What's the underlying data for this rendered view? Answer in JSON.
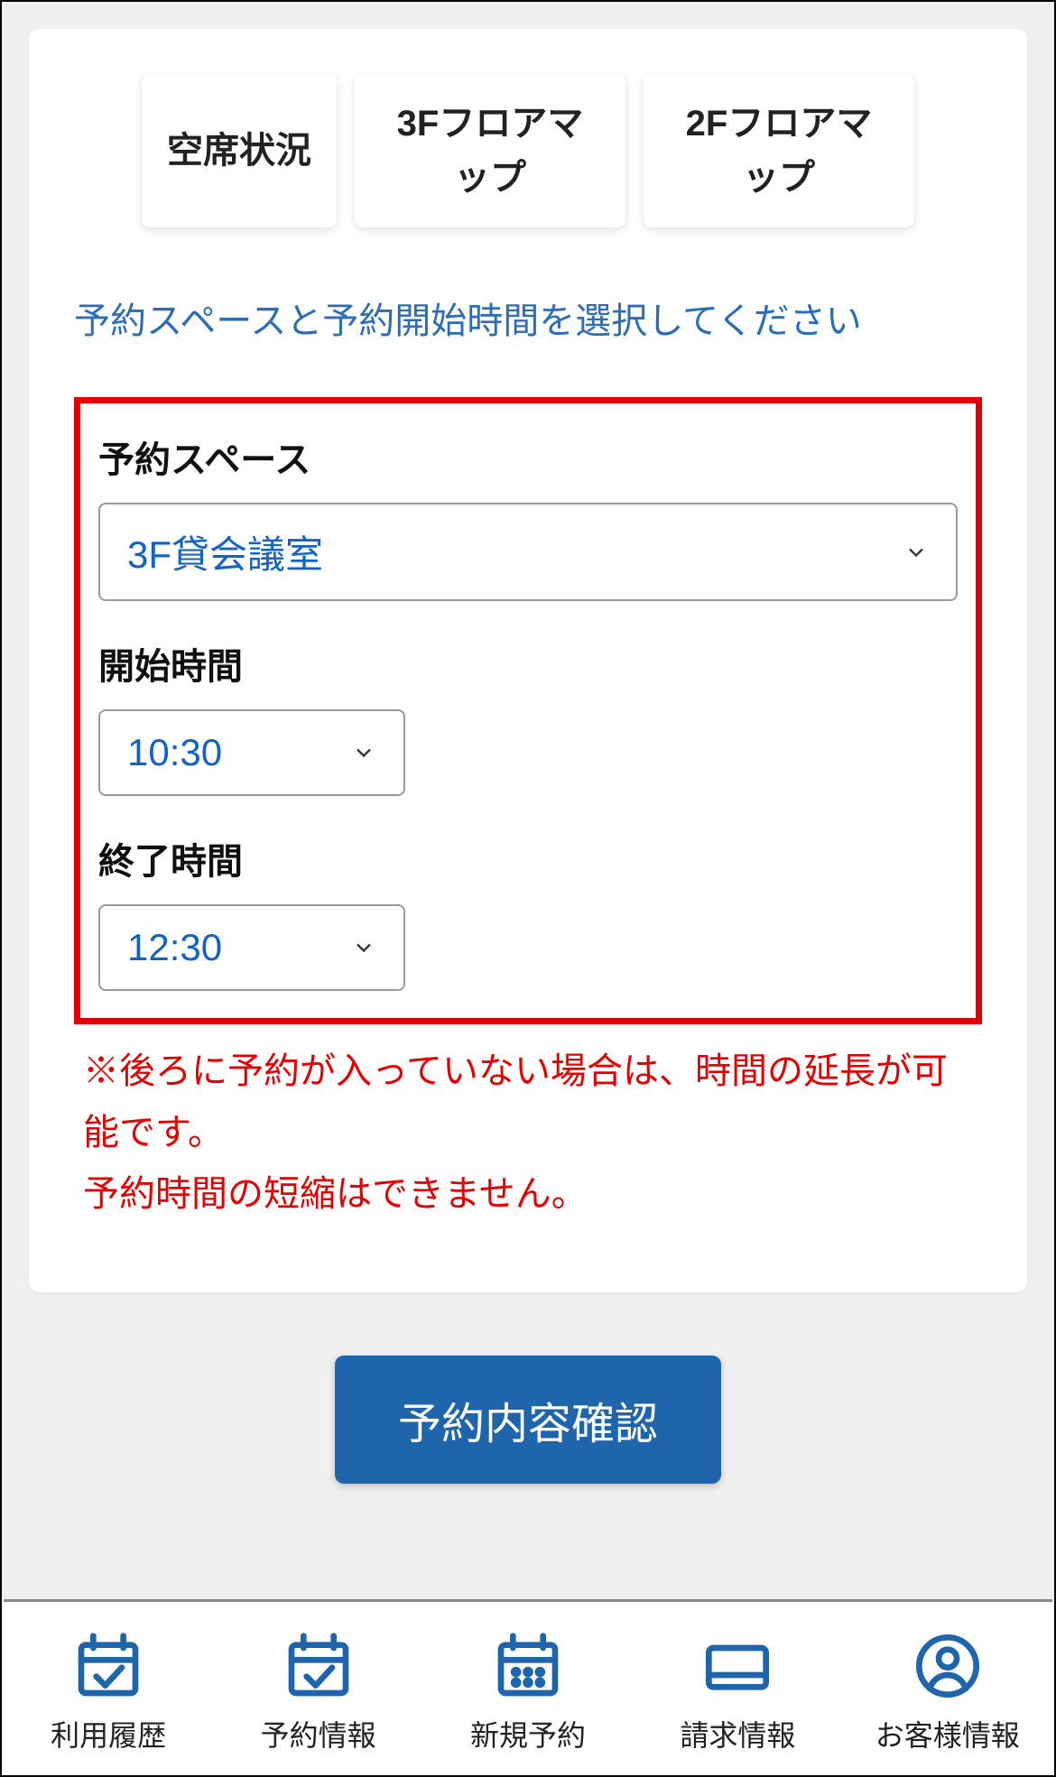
{
  "tabs": {
    "availability": "空席状況",
    "floor3": "3Fフロアマップ",
    "floor2": "2Fフロアマップ"
  },
  "prompt": "予約スペースと予約開始時間を選択してください",
  "form": {
    "space": {
      "label": "予約スペース",
      "value": "3F貸会議室"
    },
    "start": {
      "label": "開始時間",
      "value": "10:30"
    },
    "end": {
      "label": "終了時間",
      "value": "12:30"
    }
  },
  "note": "※後ろに予約が入っていない場合は、時間の延長が可能です。\n予約時間の短縮はできません。",
  "confirm": "予約内容確認",
  "nav": {
    "history": "利用履歴",
    "bookings": "予約情報",
    "new": "新規予約",
    "billing": "請求情報",
    "customer": "お客様情報"
  }
}
